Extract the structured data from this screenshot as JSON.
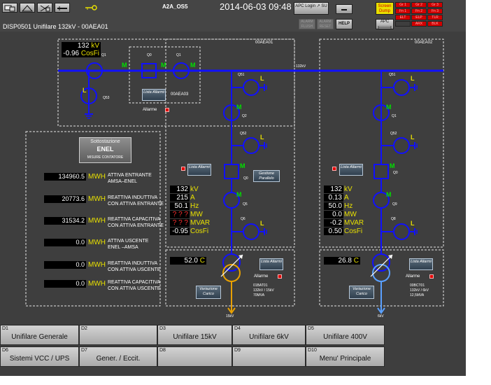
{
  "header": {
    "app_title": "A2A_OS5",
    "datetime": "2014-06-03 09:48",
    "page_title": "DISP0501  Unifilare 132kV - 00AEA01",
    "apc_login": "APC Login  ↗ SU",
    "screen_dump": "Screen Dump",
    "help": "HELP",
    "apc": "APC",
    "apc2": "APC",
    "status_cells": [
      "Gr 1",
      "Gr 2",
      "Gr 3",
      "Fn 1",
      "Fn 2",
      "Fn 3",
      "ELT",
      "ELP",
      "TLR",
      "",
      "ARX",
      "BLK"
    ],
    "grey_cells": [
      "ALARM FLUSH",
      "ALARM RESET"
    ]
  },
  "left_panel": {
    "kv": "132",
    "kv_unit": "kV",
    "cosfi": "-0.96",
    "cosfi_unit": "CosFi",
    "label_q1a": "Q1",
    "label_q0": "Q0",
    "label_q1b": "Q1",
    "label_q53": "Q53",
    "m1": "M",
    "m2": "M",
    "m3": "M",
    "lista_allarmi": "Lista Allarmi",
    "bay_code": "00AEA03",
    "allarme": "Allarme"
  },
  "substation": {
    "title1": "Sottostazione",
    "title2": "ENEL",
    "title3": "MISURE CONTATORE",
    "rows": [
      {
        "value": "134960.5",
        "unit": "MWH",
        "label": "ATTIVA ENTRANTE\nAMSA–ENEL"
      },
      {
        "value": "20773.6",
        "unit": "MWH",
        "label": "REATTIVA INDUTTIVA\nCON ATTIVA ENTRANTE"
      },
      {
        "value": "31534.2",
        "unit": "MWH",
        "label": "REATTIVA CAPACITIVA\nCON ATTIVA ENTRANTE"
      },
      {
        "value": "0.0",
        "unit": "MWH",
        "label": "ATTIVA USCENTE\nENEL –AMSA"
      },
      {
        "value": "0.0",
        "unit": "MWH",
        "label": "REATTIVA INDUTTIVA\nCON ATTIVA USCENTE"
      },
      {
        "value": "0.0",
        "unit": "MWH",
        "label": "REATTIVA CAPACITIVA\nCON ATTIVA USCENTE"
      }
    ]
  },
  "bay1": {
    "code": "00AEA01",
    "bus_label": "132kV",
    "q51": "Q51",
    "q2": "Q2",
    "q52": "Q52",
    "q0": "Q0",
    "q5": "Q5",
    "q6": "Q6",
    "lista_allarmi": "Lista Allarmi",
    "gestione": "Gestione Parallelo",
    "meas": [
      {
        "value": "132",
        "unit": "kV"
      },
      {
        "value": "215",
        "unit": "A"
      },
      {
        "value": "50.1",
        "unit": "Hz"
      },
      {
        "value": "? ? ?",
        "unit": "MW"
      },
      {
        "value": "? ? ?",
        "unit": "MVAR"
      },
      {
        "value": "-0.95",
        "unit": "CosFi"
      }
    ],
    "temp_value": "52.0",
    "temp_unit": "C",
    "lista_allarmi2": "Lista Allarmi",
    "allarme": "Allarme",
    "variazione": "Variazione Carico",
    "trafo": "01BAT01",
    "trafo_ratio": "132kV / 15kV",
    "trafo_power": "70MVA",
    "out_label": "15kV"
  },
  "bay2": {
    "code": "00AEA02",
    "q51": "Q51",
    "q1": "Q1",
    "q52": "Q52",
    "q0": "Q0",
    "q9": "Q9",
    "q8": "Q8",
    "lista_allarmi": "Lista Allarmi",
    "meas": [
      {
        "value": "132",
        "unit": "kV"
      },
      {
        "value": "0.13",
        "unit": "A"
      },
      {
        "value": "50.0",
        "unit": "Hz"
      },
      {
        "value": "0.0",
        "unit": "MW"
      },
      {
        "value": "-0.2",
        "unit": "MVAR"
      },
      {
        "value": "0.50",
        "unit": "CosFi"
      }
    ],
    "temp_value": "26.8",
    "temp_unit": "C",
    "lista_allarmi2": "Lista Allarmi",
    "allarme": "Allarme",
    "variazione": "Variazione Carico",
    "trafo": "00BCT01",
    "trafo_ratio": "132kV / 6kV",
    "trafo_power": "12,5MVA",
    "out_label": "6kV"
  },
  "nav": [
    {
      "num": "D1",
      "label": "Unifilare Generale"
    },
    {
      "num": "D2",
      "label": ""
    },
    {
      "num": "D3",
      "label": "Unifilare 15kV"
    },
    {
      "num": "D4",
      "label": "Unifilare 6kV"
    },
    {
      "num": "D5",
      "label": "Unifilare 400V"
    },
    {
      "num": "D6",
      "label": "Sistemi VCC / UPS"
    },
    {
      "num": "D7",
      "label": "Gener. / Eccit."
    },
    {
      "num": "D8",
      "label": ""
    },
    {
      "num": "D9",
      "label": ""
    },
    {
      "num": "D10",
      "label": "Menu' Principale"
    }
  ],
  "colors": {
    "background": "#3e3e3e",
    "busbar": "#1010ff",
    "breaker": "#1010ff",
    "motor": "#00e000",
    "load": "#e8e000",
    "alarm": "#e10000",
    "out_15kv": "#e8a000",
    "out_6kv": "#5aa0ff"
  }
}
